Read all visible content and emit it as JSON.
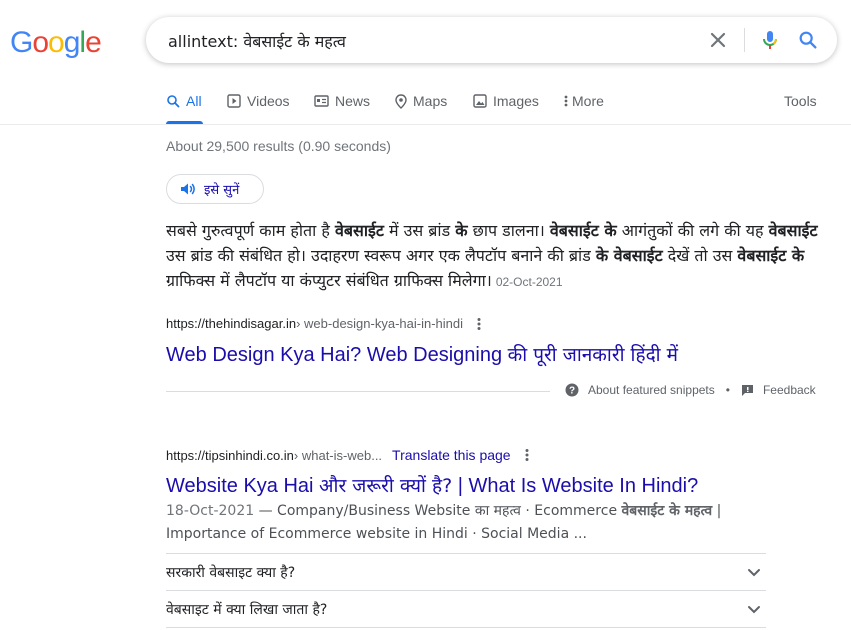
{
  "header": {
    "logo_text": "Google",
    "search": {
      "value": "allintext: वेबसाईट के महत्व"
    }
  },
  "tabs": [
    {
      "label": "All",
      "icon": "search-icon",
      "active": true
    },
    {
      "label": "Videos",
      "icon": "video-icon"
    },
    {
      "label": "News",
      "icon": "news-icon"
    },
    {
      "label": "Maps",
      "icon": "map-pin-icon"
    },
    {
      "label": "Images",
      "icon": "image-icon"
    },
    {
      "label": "More",
      "icon": "more-vert-icon"
    }
  ],
  "tools_label": "Tools",
  "results_count": "About 29,500 results (0.90 seconds)",
  "listen_label": "इसे सुनें",
  "featured_snippet": {
    "parts": [
      {
        "t": "सबसे गुरुत्वपूर्ण काम होता है ",
        "b": false
      },
      {
        "t": "वेबसाईट",
        "b": true
      },
      {
        "t": " में उस ब्रांड ",
        "b": false
      },
      {
        "t": "के",
        "b": true
      },
      {
        "t": " छाप डालना। ",
        "b": false
      },
      {
        "t": "वेबसाईट के",
        "b": true
      },
      {
        "t": " आगंतुकों की लगे की यह ",
        "b": false
      },
      {
        "t": "वेबसाईट",
        "b": true
      },
      {
        "t": " उस ब्रांड की संबंधित हो। उदाहरण स्वरूप अगर एक लैपटॉप बनाने की ब्रांड ",
        "b": false
      },
      {
        "t": "के वेबसाईट",
        "b": true
      },
      {
        "t": " देखें तो उस ",
        "b": false
      },
      {
        "t": "वेबसाईट के",
        "b": true
      },
      {
        "t": " ग्राफिक्स में लैपटॉप या कंप्युटर संबंधित ग्राफिक्स मिलेगा।",
        "b": false
      }
    ],
    "date": "02-Oct-2021",
    "cite_domain": "https://thehindisagar.in",
    "cite_path": " › web-design-kya-hai-in-hindi",
    "title_en": "Web Design Kya Hai? Web Designing ",
    "title_hi": "की पूरी जानकारी हिंदी में",
    "about_label": "About featured snippets",
    "feedback_label": "Feedback"
  },
  "result2": {
    "cite_domain": "https://tipsinhindi.co.in",
    "cite_path": " › what-is-web...",
    "translate_label": "Translate this page",
    "title_a": "Website Kya Hai ",
    "title_hi": "और जरूरी क्यों है?",
    "title_b": " | What Is Website In Hindi?",
    "desc_date": "18-Oct-2021",
    "desc_parts": [
      {
        "t": " — Company/Business Website का महत्व · Ecommerce ",
        "b": false
      },
      {
        "t": "वेबसाईट के महत्व",
        "b": true
      },
      {
        "t": " | Importance of Ecommerce website in Hindi · Social Media ...",
        "b": false
      }
    ]
  },
  "people_also_ask": [
    "सरकारी वेबसाइट क्या है?",
    "वेबसाइट में क्या लिखा जाता है?"
  ]
}
